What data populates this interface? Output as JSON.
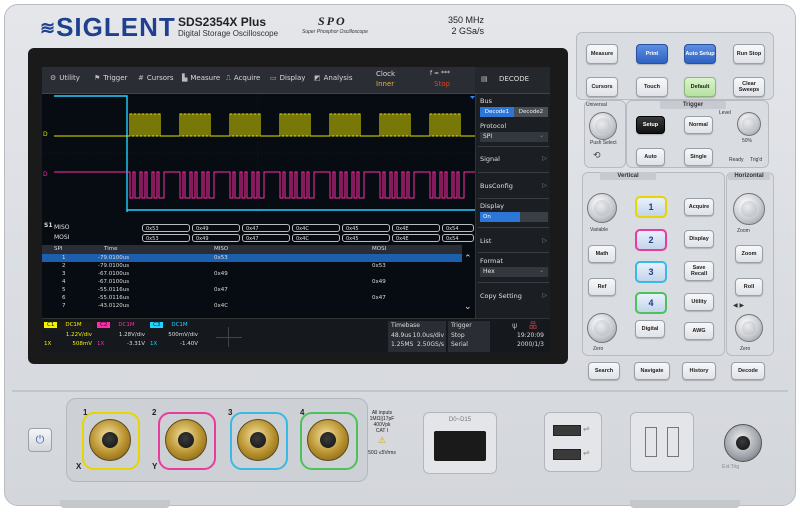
{
  "brand": {
    "logo": "SIGLENT",
    "model": "SDS2354X Plus",
    "model_sub": "Digital Storage Oscilloscope",
    "spo": "SPO",
    "spo_sub": "Super Phosphor Oscilloscope",
    "bandwidth": "350 MHz",
    "sample_rate": "2 GSa/s"
  },
  "menubar": {
    "items": [
      {
        "icon": "⚙",
        "label": "Utility"
      },
      {
        "icon": "⚑",
        "label": "Trigger"
      },
      {
        "icon": "#",
        "label": "Cursors"
      },
      {
        "icon": "▙",
        "label": "Measure"
      },
      {
        "icon": "⎍",
        "label": "Acquire"
      },
      {
        "icon": "▭",
        "label": "Display"
      },
      {
        "icon": "◩",
        "label": "Analysis"
      }
    ],
    "clock_label": "Clock",
    "clock_value": "Inner",
    "freq_label": "f = ***",
    "freq_value": "Stop",
    "decode_label": "DECODE"
  },
  "bus_rows": {
    "miso_label": "MISO",
    "mosi_label": "MOSI",
    "miso": [
      "0x53",
      "0x49",
      "0x47",
      "0x4C",
      "0x45",
      "0x4E",
      "0x54"
    ],
    "mosi": [
      "0x53",
      "0x49",
      "0x47",
      "0x4C",
      "0x45",
      "0x4E",
      "0x54"
    ],
    "s1_label": "S1"
  },
  "table": {
    "headers": [
      "SPI",
      "Time",
      "MISO",
      "MOSI"
    ],
    "rows": [
      {
        "index": "1",
        "time": "-79.0100us",
        "miso": "0x53",
        "mosi": ""
      },
      {
        "index": "2",
        "time": "-79.0100us",
        "miso": "",
        "mosi": "0x53"
      },
      {
        "index": "3",
        "time": "-67.0100us",
        "miso": "0x49",
        "mosi": ""
      },
      {
        "index": "4",
        "time": "-67.0100us",
        "miso": "",
        "mosi": "0x49"
      },
      {
        "index": "5",
        "time": "-55.0116us",
        "miso": "0x47",
        "mosi": ""
      },
      {
        "index": "6",
        "time": "-55.0116us",
        "miso": "",
        "mosi": "0x47"
      },
      {
        "index": "7",
        "time": "-43.0120us",
        "miso": "0x4C",
        "mosi": ""
      }
    ]
  },
  "right_panel": {
    "bus_label": "Bus",
    "decode1": "Decode1",
    "decode2": "Decode2",
    "protocol_label": "Protocol",
    "protocol_value": "SPI",
    "signal_label": "Signal",
    "busconfig_label": "BusConfig",
    "display_label": "Display",
    "display_value": "On",
    "list_label": "List",
    "format_label": "Format",
    "format_value": "Hex",
    "copy_label": "Copy Setting"
  },
  "status": {
    "ch1": {
      "name": "C1",
      "coupling": "DC1M",
      "vdiv": "1.22V/div",
      "probe": "1X",
      "offset": "508mV"
    },
    "ch2": {
      "name": "C2",
      "coupling": "DC1M",
      "vdiv": "1.28V/div",
      "probe": "1X",
      "offset": "-3.31V"
    },
    "ch3": {
      "name": "C3",
      "coupling": "DC1M",
      "vdiv": "500mV/div",
      "probe": "1X",
      "offset": "-1.40V"
    },
    "timebase_label": "Timebase",
    "timebase_delay": "48.9us",
    "timebase_div": "10.0us/div",
    "mem_depth": "1.25MS",
    "srate": "2.50GS/s",
    "trigger_label": "Trigger",
    "trigger_state": "Stop",
    "trigger_source": "Serial",
    "time": "19:20:09",
    "date": "2000/1/3"
  },
  "panel": {
    "top_buttons": [
      "Measure",
      "Print",
      "Auto Setup",
      "Run Stop",
      "Cursors",
      "Touch",
      "Default",
      "Clear Sweeps"
    ],
    "universal_label": "Universal",
    "push_select": "Push Select",
    "trigger_group": "Trigger",
    "trigger_buttons": [
      "Setup",
      "Normal",
      "Auto",
      "Single"
    ],
    "level_label": "Level",
    "level_sub": "50%",
    "ready": "Ready",
    "trigd": "Trig'd",
    "vertical_group": "Vertical",
    "horizontal_group": "Horizontal",
    "variable_label": "Variable",
    "zero_label": "Zero",
    "zoom_label": "Zoom",
    "channel_buttons": [
      "1",
      "2",
      "3",
      "4"
    ],
    "vertical_buttons": [
      "Math",
      "Ref",
      "Digital"
    ],
    "mid_buttons": [
      "Acquire",
      "Display",
      "Save Recall",
      "Utility",
      "AWG"
    ],
    "horizontal_buttons": [
      "Zoom",
      "Roll"
    ],
    "bottom_buttons": [
      "Search",
      "Navigate",
      "History",
      "Decode"
    ]
  },
  "front": {
    "ch_labels": [
      "1",
      "2",
      "3",
      "4"
    ],
    "x_label": "X",
    "y_label": "Y",
    "input_spec_1": "All inputs",
    "input_spec_2": "1MΩ||17pF",
    "input_spec_3": "400Vpk",
    "input_spec_4": "CAT I",
    "input_spec_5": "50Ω ≤5Vrms",
    "digital_label": "D0~D15",
    "ext_trig": "Ext.Trig"
  },
  "colors": {
    "ch1": "#f5f000",
    "ch2": "#ff2ba8",
    "ch3": "#23d3ff",
    "ch4": "#3bd64a",
    "accent_blue": "#2f62c4"
  }
}
